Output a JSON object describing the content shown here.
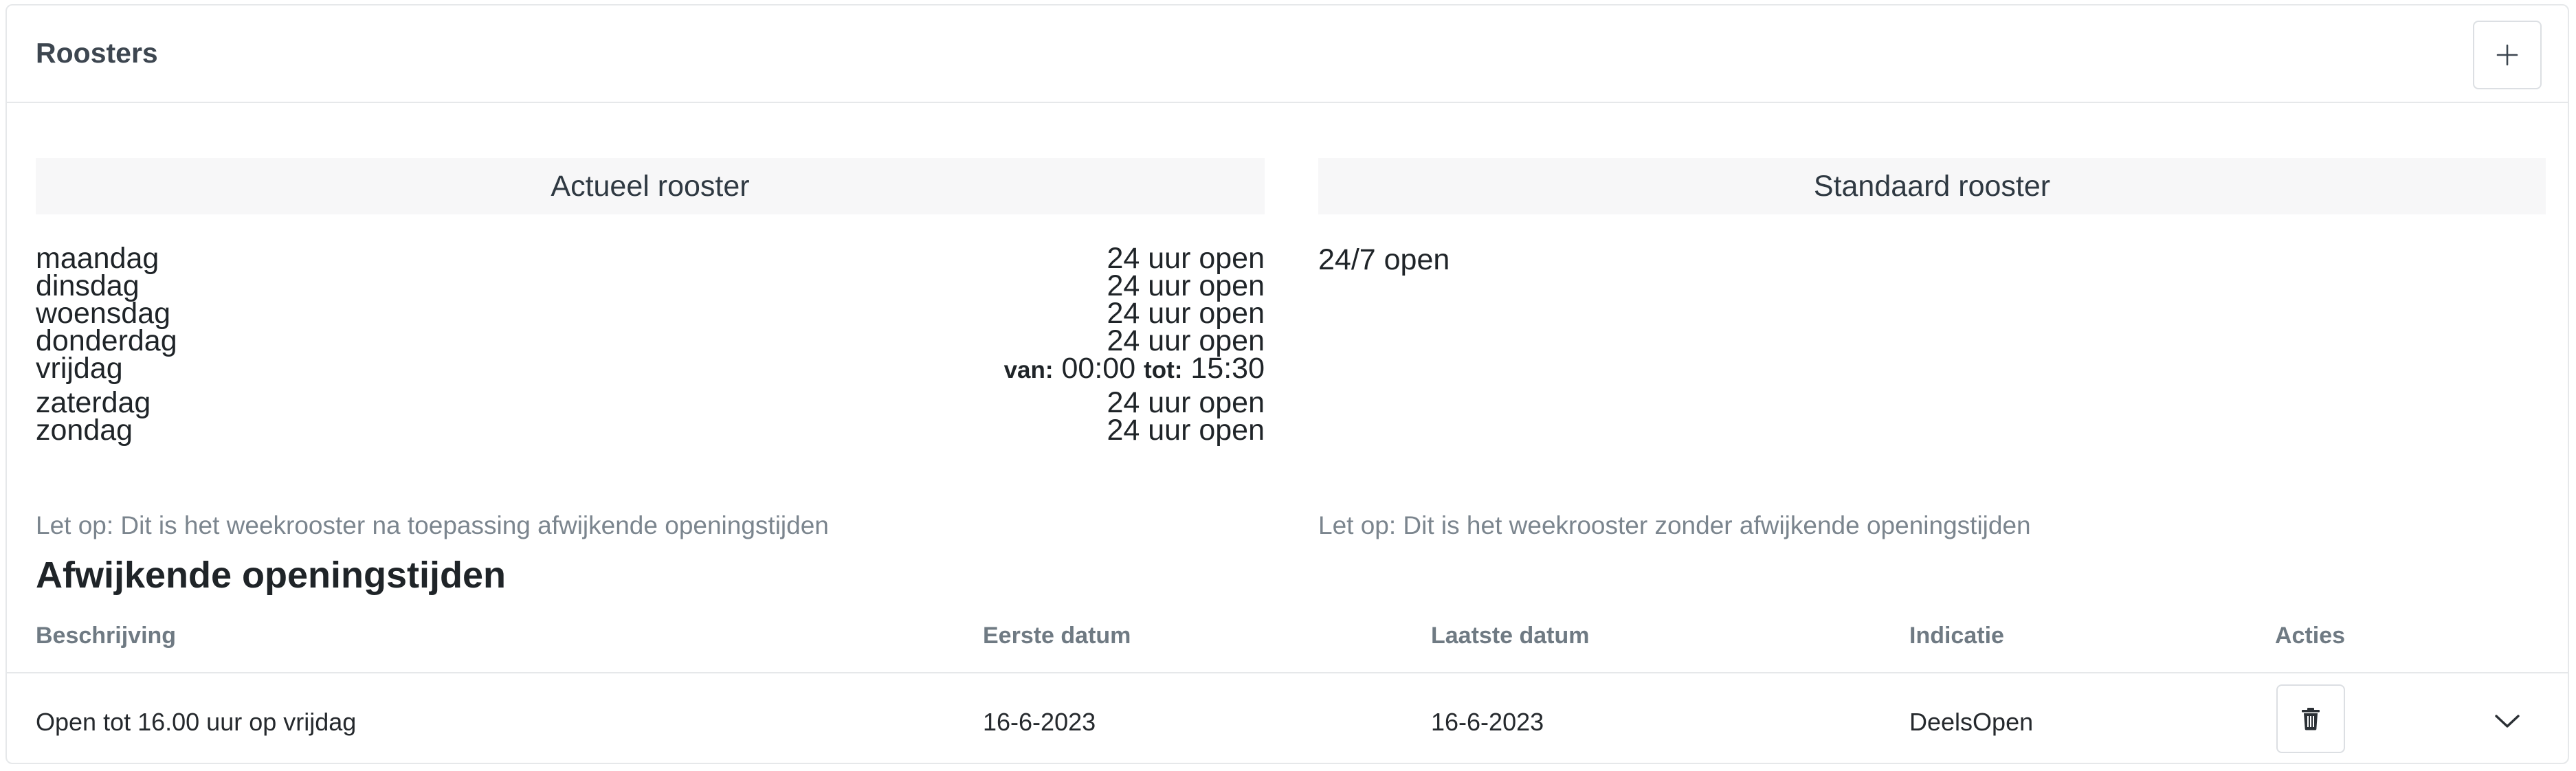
{
  "header": {
    "title": "Roosters",
    "add_icon": "plus-icon"
  },
  "actueel": {
    "title": "Actueel rooster",
    "days": [
      {
        "day": "maandag",
        "hours": "24 uur open"
      },
      {
        "day": "dinsdag",
        "hours": "24 uur open"
      },
      {
        "day": "woensdag",
        "hours": "24 uur open"
      },
      {
        "day": "donderdag",
        "hours": "24 uur open"
      },
      {
        "day": "vrijdag",
        "van_label": "van:",
        "van": "00:00",
        "tot_label": "tot:",
        "tot": "15:30"
      },
      {
        "day": "zaterdag",
        "hours": "24 uur open"
      },
      {
        "day": "zondag",
        "hours": "24 uur open"
      }
    ],
    "note": "Let op: Dit is het weekrooster na toepassing afwijkende openingstijden"
  },
  "standaard": {
    "title": "Standaard rooster",
    "text": "24/7 open",
    "note": "Let op: Dit is het weekrooster zonder afwijkende openingstijden"
  },
  "afwijkend": {
    "title": "Afwijkende openingstijden",
    "columns": [
      "Beschrijving",
      "Eerste datum",
      "Laatste datum",
      "Indicatie",
      "Acties"
    ],
    "rows": [
      {
        "beschrijving": "Open tot 16.00 uur op vrijdag",
        "eerste_datum": "16-6-2023",
        "laatste_datum": "16-6-2023",
        "indicatie": "DeelsOpen",
        "delete_icon": "trash-icon",
        "expand_icon": "chevron-down-icon"
      }
    ]
  }
}
